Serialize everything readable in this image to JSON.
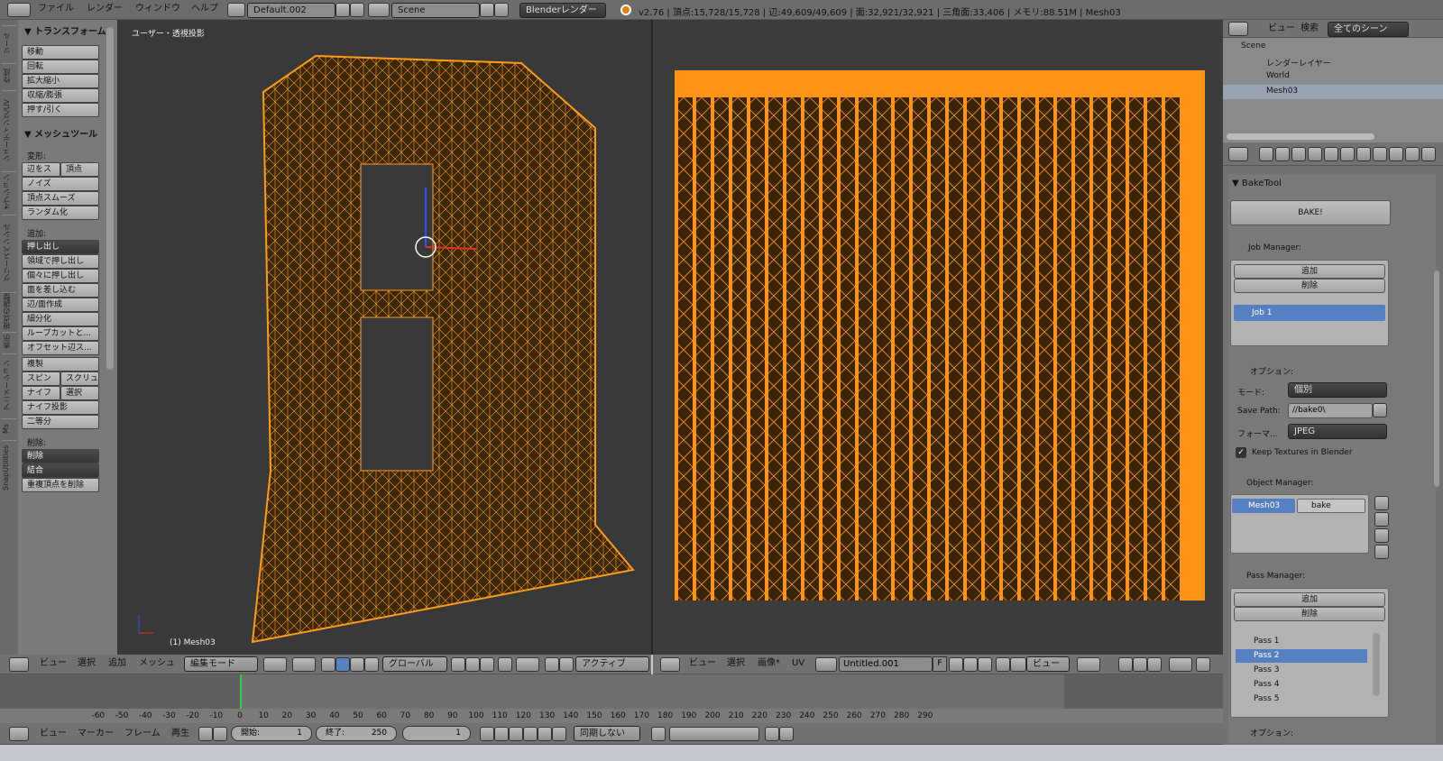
{
  "topbar": {
    "menus": [
      "ファイル",
      "レンダー",
      "ウィンドウ",
      "ヘルプ"
    ],
    "layout": "Default.002",
    "scene": "Scene",
    "engine": "Blenderレンダー",
    "stats": "v2.76 | 頂点:15,728/15,728 | 辺:49,609/49,609 | 面:32,921/32,921 | 三角面:33,406 | メモリ:88.51M | Mesh03"
  },
  "toolshelf": {
    "vtabs": [
      "ツール",
      "作成",
      "シェーディング/UV",
      "オプション",
      "グリースペンシル",
      "視点の調整",
      "表示",
      "アニメーション",
      "Ms",
      "SnapUtilities"
    ],
    "transform_header": "▼ トランスフォーム",
    "transform_items": [
      "移動",
      "回転",
      "拡大縮小",
      "収縮/膨張",
      "押す/引く"
    ],
    "mesh_header": "▼ メッシュツール",
    "deform_label": "変形:",
    "deform_row": [
      "辺をス",
      "頂点"
    ],
    "deform_items": [
      "ノイズ",
      "頂点スムーズ",
      "ランダム化"
    ],
    "add_label": "追加:",
    "add_extrude": "押し出し",
    "add_items": [
      "領域で押し出し",
      "個々に押し出し",
      "面を差し込む",
      "辺/面作成",
      "細分化",
      "ループカットと...",
      "オフセット辺ス..."
    ],
    "dup": "複製",
    "spin_row": [
      "スピン",
      "スクリュ"
    ],
    "knife_row": [
      "ナイフ",
      "選択"
    ],
    "add_tail": [
      "ナイフ投影",
      "二等分"
    ],
    "delete_label": "削除:",
    "delete_dd": "削除",
    "merge_dd": "結合",
    "remove_doubles": "重複頂点を削除"
  },
  "viewport": {
    "title": "ユーザー・透視投影",
    "object": "(1) Mesh03",
    "header": [
      "ビュー",
      "選択",
      "追加",
      "メッシュ"
    ],
    "mode": "編集モード",
    "orientation": "グローバル",
    "pivot": "アクティブ"
  },
  "uv_editor": {
    "header": [
      "ビュー",
      "選択",
      "画像*",
      "UV"
    ],
    "image": "Untitled.001",
    "f": "F",
    "view": "ビュー"
  },
  "outliner": {
    "header": [
      "ビュー",
      "検索"
    ],
    "scenes": "全てのシーン",
    "items": [
      "Scene",
      "レンダーレイヤー",
      "World",
      "Mesh03"
    ]
  },
  "baketool": {
    "title": "▼ BakeTool",
    "bake": "BAKE!",
    "job_manager": "Job Manager:",
    "add": "追加",
    "remove": "削除",
    "job": "Job 1",
    "options": "オプション:",
    "mode_label": "モード:",
    "mode_value": "個別",
    "save_label": "Save Path:",
    "save_value": "//bake0\\",
    "format_label": "フォーマ...",
    "format_value": "JPEG",
    "keep_textures": "Keep Textures in Blender",
    "object_manager": "Object Manager:",
    "object": "Mesh03",
    "object_bake": "bake",
    "pass_manager": "Pass Manager:",
    "passes": [
      "Pass 1",
      "Pass 2",
      "Pass 3",
      "Pass 4",
      "Pass 5"
    ],
    "options2": "オプション:"
  },
  "timeline": {
    "ticks": [
      "-60",
      "-50",
      "-40",
      "-30",
      "-20",
      "-10",
      "0",
      "10",
      "20",
      "30",
      "40",
      "50",
      "60",
      "70",
      "80",
      "90",
      "100",
      "110",
      "120",
      "130",
      "140",
      "150",
      "160",
      "170",
      "180",
      "190",
      "200",
      "210",
      "220",
      "230",
      "240",
      "250",
      "260",
      "270",
      "280",
      "290"
    ],
    "header": [
      "ビュー",
      "マーカー",
      "フレーム",
      "再生"
    ],
    "start_label": "開始:",
    "start": "1",
    "end_label": "終了:",
    "end": "250",
    "current": "1",
    "sync": "同期しない"
  }
}
